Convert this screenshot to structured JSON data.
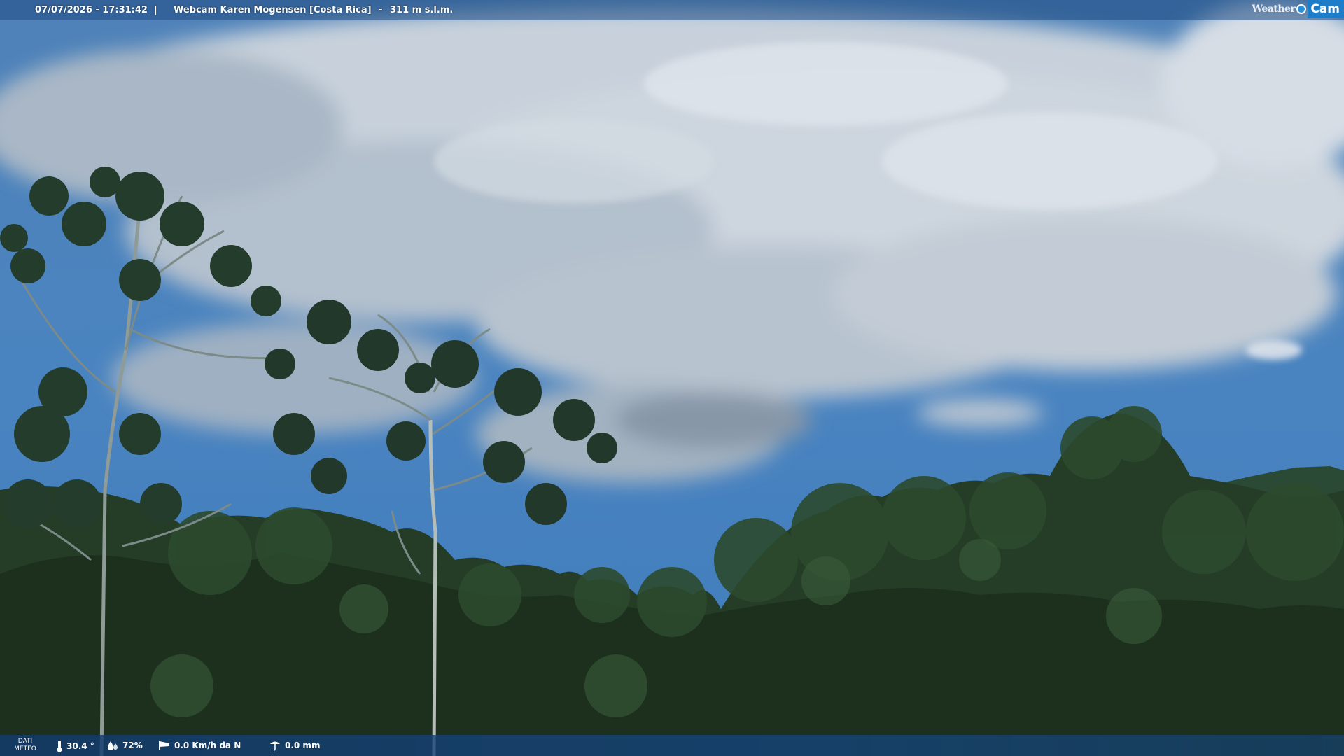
{
  "header": {
    "timestamp": "07/07/2026 - 17:31:42",
    "separator": "|",
    "title": "Webcam Karen Mogensen [Costa Rica]",
    "altitude": "311 m s.l.m.",
    "altitude_separator": "-"
  },
  "logo": {
    "word_part": "Weather",
    "cam_part": "Cam"
  },
  "weather": {
    "label_line1": "DATI",
    "label_line2": "METEO",
    "temperature": "30.4 °",
    "humidity": "72%",
    "wind": "0.0 Km/h da N",
    "rain": "0.0 mm"
  },
  "icons": {
    "temperature": "thermometer-icon",
    "humidity": "water-drops-icon",
    "wind": "wind-sock-icon",
    "rain": "rain-gauge-icon"
  },
  "colors": {
    "sky": "#3f77b4",
    "cloud": "#c9d2dc",
    "forest": "#1f3520",
    "bar": "#1e4b82",
    "logo_cam": "#1d7dc9"
  }
}
